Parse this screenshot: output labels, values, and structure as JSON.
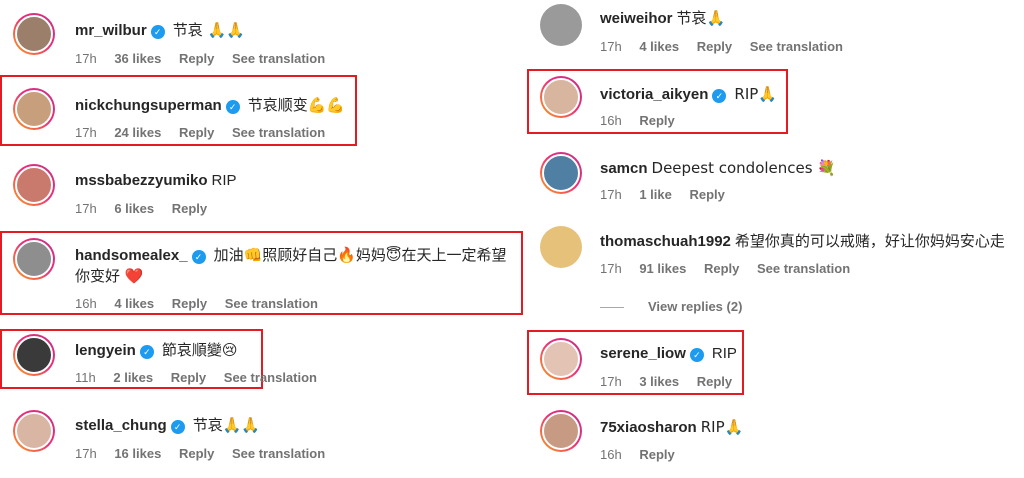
{
  "verified_mark": "✓",
  "colors": {
    "highlight": "#e31b23",
    "verified": "#1d9bf0",
    "meta": "#737373",
    "ring_start": "#f9a11b",
    "ring_end": "#c13584"
  },
  "actions": {
    "reply": "Reply",
    "see_translation": "See translation"
  },
  "left": [
    {
      "user": "mr_wilbur",
      "verified": true,
      "text": "节哀 🙏🙏",
      "time": "17h",
      "likes": "36 likes",
      "translation": true,
      "highlighted": false
    },
    {
      "user": "nickchungsuperman",
      "verified": true,
      "text": "节哀顺变💪💪",
      "time": "17h",
      "likes": "24 likes",
      "translation": true,
      "highlighted": true
    },
    {
      "user": "mssbabezzyumiko",
      "verified": false,
      "text": "RIP",
      "time": "17h",
      "likes": "6 likes",
      "translation": false,
      "highlighted": false
    },
    {
      "user": "handsomealex_",
      "verified": true,
      "text": "加油👊照顾好自己🔥妈妈😇在天上一定希望你变好 ❤️",
      "time": "16h",
      "likes": "4 likes",
      "translation": true,
      "highlighted": true
    },
    {
      "user": "lengyein",
      "verified": true,
      "text": "節哀順變😢",
      "time": "11h",
      "likes": "2 likes",
      "translation": true,
      "highlighted": true
    },
    {
      "user": "stella_chung",
      "verified": true,
      "text": "节哀🙏🙏",
      "time": "17h",
      "likes": "16 likes",
      "translation": true,
      "highlighted": false
    }
  ],
  "right": [
    {
      "user": "weiweihor",
      "verified": false,
      "text": "节哀🙏",
      "time": "17h",
      "likes": "4 likes",
      "translation": true,
      "highlighted": false
    },
    {
      "user": "victoria_aikyen",
      "verified": true,
      "text": "RIP🙏",
      "time": "16h",
      "likes": "",
      "translation": false,
      "highlighted": true
    },
    {
      "user": "samcn",
      "verified": false,
      "text": "Deepest condolences 💐",
      "time": "17h",
      "likes": "1 like",
      "translation": false,
      "highlighted": false
    },
    {
      "user": "thomaschuah1992",
      "verified": false,
      "text": "希望你真的可以戒赌，好让你妈妈安心走",
      "time": "17h",
      "likes": "91 likes",
      "translation": true,
      "highlighted": false,
      "view_replies": "View replies (2)"
    },
    {
      "user": "serene_liow",
      "verified": true,
      "text": "RIP",
      "time": "17h",
      "likes": "3 likes",
      "translation": false,
      "highlighted": true
    },
    {
      "user": "75xiaosharon",
      "verified": false,
      "text": "RIP🙏",
      "time": "16h",
      "likes": "",
      "translation": false,
      "highlighted": false
    }
  ]
}
